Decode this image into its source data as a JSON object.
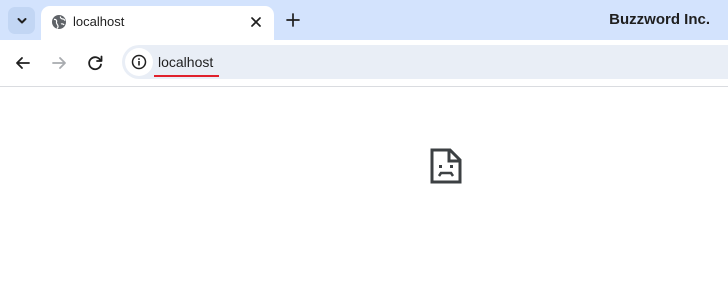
{
  "tabbar": {
    "tab_search_icon": "chevron-down-icon",
    "tab": {
      "title": "localhost",
      "favicon": "globe-icon",
      "close_icon": "close-icon"
    },
    "new_tab_icon": "plus-icon",
    "brand": "Buzzword Inc."
  },
  "toolbar": {
    "back_icon": "arrow-left-icon",
    "forward_icon": "arrow-right-icon",
    "reload_icon": "reload-icon",
    "site_info_icon": "info-icon",
    "url": "localhost"
  },
  "content": {
    "error_icon": "sad-document-icon"
  },
  "colors": {
    "tabbar_bg": "#d3e3fd",
    "omnibox_bg": "#e9eef6",
    "underline": "#e0202b"
  }
}
